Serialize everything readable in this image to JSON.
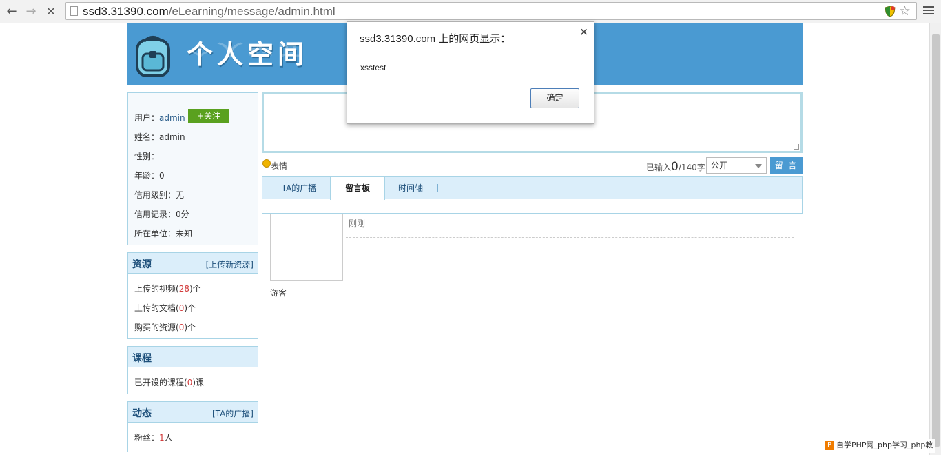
{
  "browser": {
    "url_domain": "ssd3.31390.com",
    "url_path": "/eLearning/message/admin.html",
    "back_glyph": "←",
    "forward_glyph": "→",
    "stop_glyph": "✕",
    "star_glyph": "☆"
  },
  "header": {
    "title": "个人空间"
  },
  "profile": {
    "user_label": "用户：",
    "user_value": "admin",
    "follow_label": "+关注",
    "name_label": "姓名：",
    "name_value": "admin",
    "gender_label": "性别：",
    "gender_value": "",
    "age_label": "年龄：",
    "age_value": "0",
    "credit_level_label": "信用级别：",
    "credit_level_value": "无",
    "credit_record_label": "信用记录：",
    "credit_record_value": "0分",
    "unit_label": "所在单位：",
    "unit_value": "未知"
  },
  "resources": {
    "title": "资源",
    "link": "[上传新资源]",
    "videos_prefix": "上传的视频(",
    "videos_count": "28",
    "videos_suffix": ")个",
    "docs_prefix": "上传的文档(",
    "docs_count": "0",
    "docs_suffix": ")个",
    "bought_prefix": "购买的资源(",
    "bought_count": "0",
    "bought_suffix": ")个"
  },
  "courses": {
    "title": "课程",
    "opened_prefix": "已开设的课程(",
    "opened_count": "0",
    "opened_suffix": ")课"
  },
  "dynamics": {
    "title": "动态",
    "link": "[TA的广播]",
    "fans_label": "粉丝：",
    "fans_count": "1",
    "fans_suffix": "人"
  },
  "composer": {
    "emoji_label": "表情",
    "counter_prefix": "已输入",
    "counter_value": "0",
    "counter_suffix": "/140字",
    "visibility": "公开",
    "submit_label": "留 言"
  },
  "tabs": [
    {
      "label": "TA的广播"
    },
    {
      "label": "留言板"
    },
    {
      "label": "时间轴"
    }
  ],
  "messages": [
    {
      "poster": "游客",
      "time": "刚刚"
    }
  ],
  "dialog": {
    "title": "ssd3.31390.com 上的网页显示：",
    "message": "xsstest",
    "ok_label": "确定",
    "close_glyph": "×"
  },
  "watermark": {
    "logo": "P",
    "text": "自学PHP网_php学习_php教"
  }
}
